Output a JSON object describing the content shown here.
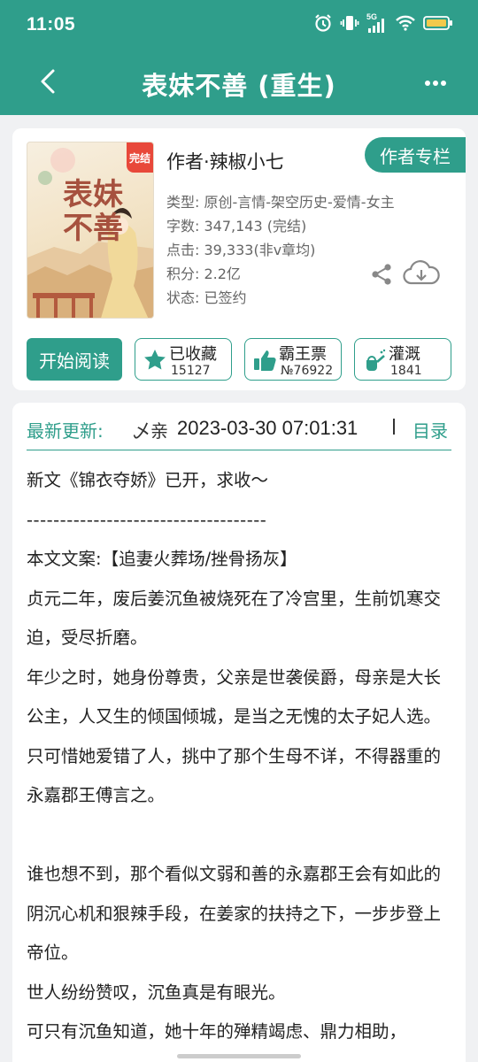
{
  "status_bar": {
    "time": "11:05",
    "network": "5G"
  },
  "app_bar": {
    "title": "表妹不善 (重生)"
  },
  "book": {
    "cover_title": "表妹不善",
    "cover_badge": "完结",
    "author": "作者·辣椒小七",
    "author_button": "作者专栏",
    "meta": {
      "type": "类型: 原创-言情-架空历史-爱情-女主",
      "words": "字数: 347,143 (完结)",
      "clicks": "点击: 39,333(非v章均)",
      "points": "积分: 2.2亿",
      "status": "状态: 已签约"
    },
    "start_button": "开始阅读",
    "actions": [
      {
        "label": "已收藏",
        "count": "15127",
        "icon": "star-icon"
      },
      {
        "label": "霸王票",
        "count": "№76922",
        "icon": "thumbs-up-icon"
      },
      {
        "label": "灌溉",
        "count": "1841",
        "icon": "watering-can-icon"
      }
    ]
  },
  "update": {
    "label": "最新更新:",
    "chapter": "乄亲",
    "time": "2023-03-30 07:01:31",
    "toc_button": "目录"
  },
  "intro": {
    "line1": "新文《锦衣夺娇》已开，求收～",
    "divider": "------------------------------------",
    "line2": "本文文案:【追妻火葬场/挫骨扬灰】",
    "p1": "贞元二年，废后姜沉鱼被烧死在了冷宫里，生前饥寒交迫，受尽折磨。",
    "p2": "年少之时，她身份尊贵，父亲是世袭侯爵，母亲是大长公主，人又生的倾国倾城，是当之无愧的太子妃人选。",
    "p3": "只可惜她爱错了人，挑中了那个生母不详，不得器重的永嘉郡王傅言之。",
    "p4": "谁也想不到，那个看似文弱和善的永嘉郡王会有如此的阴沉心机和狠辣手段，在姜家的扶持之下，一步步登上帝位。",
    "p5": "世人纷纷赞叹，沉鱼真是有眼光。",
    "p6": "可只有沉鱼知道，她十年的殚精竭虑、鼎力相助，"
  },
  "colors": {
    "accent": "#2f9e8b",
    "background": "#f0f1f3",
    "badge": "#e8483a"
  }
}
